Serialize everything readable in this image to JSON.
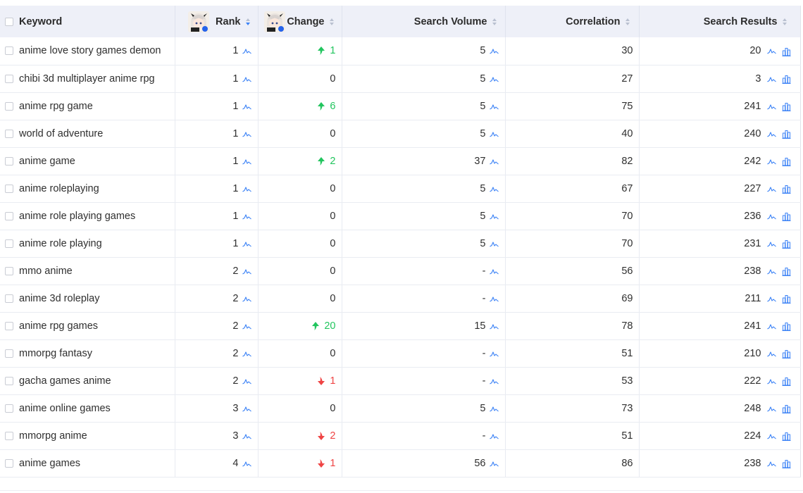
{
  "headers": {
    "keyword": "Keyword",
    "rank": "Rank",
    "change": "Change",
    "search_volume": "Search Volume",
    "correlation": "Correlation",
    "search_results": "Search Results"
  },
  "colors": {
    "up": "#22c55e",
    "down": "#ef4444",
    "icon": "#3b82f6",
    "header_bg": "#eef0f8"
  },
  "rows": [
    {
      "keyword": "anime love story games demon",
      "rank": "1",
      "change": "1",
      "dir": "up",
      "volume": "5",
      "correlation": "30",
      "results": "20"
    },
    {
      "keyword": "chibi 3d multiplayer anime rpg",
      "rank": "1",
      "change": "0",
      "dir": "none",
      "volume": "5",
      "correlation": "27",
      "results": "3"
    },
    {
      "keyword": "anime rpg game",
      "rank": "1",
      "change": "6",
      "dir": "up",
      "volume": "5",
      "correlation": "75",
      "results": "241"
    },
    {
      "keyword": "world of adventure",
      "rank": "1",
      "change": "0",
      "dir": "none",
      "volume": "5",
      "correlation": "40",
      "results": "240"
    },
    {
      "keyword": "anime game",
      "rank": "1",
      "change": "2",
      "dir": "up",
      "volume": "37",
      "correlation": "82",
      "results": "242"
    },
    {
      "keyword": "anime roleplaying",
      "rank": "1",
      "change": "0",
      "dir": "none",
      "volume": "5",
      "correlation": "67",
      "results": "227"
    },
    {
      "keyword": "anime role playing games",
      "rank": "1",
      "change": "0",
      "dir": "none",
      "volume": "5",
      "correlation": "70",
      "results": "236"
    },
    {
      "keyword": "anime role playing",
      "rank": "1",
      "change": "0",
      "dir": "none",
      "volume": "5",
      "correlation": "70",
      "results": "231"
    },
    {
      "keyword": "mmo anime",
      "rank": "2",
      "change": "0",
      "dir": "none",
      "volume": "-",
      "correlation": "56",
      "results": "238"
    },
    {
      "keyword": "anime 3d roleplay",
      "rank": "2",
      "change": "0",
      "dir": "none",
      "volume": "-",
      "correlation": "69",
      "results": "211"
    },
    {
      "keyword": "anime rpg games",
      "rank": "2",
      "change": "20",
      "dir": "up",
      "volume": "15",
      "correlation": "78",
      "results": "241"
    },
    {
      "keyword": "mmorpg fantasy",
      "rank": "2",
      "change": "0",
      "dir": "none",
      "volume": "-",
      "correlation": "51",
      "results": "210"
    },
    {
      "keyword": "gacha games anime",
      "rank": "2",
      "change": "1",
      "dir": "down",
      "volume": "-",
      "correlation": "53",
      "results": "222"
    },
    {
      "keyword": "anime online games",
      "rank": "3",
      "change": "0",
      "dir": "none",
      "volume": "5",
      "correlation": "73",
      "results": "248"
    },
    {
      "keyword": "mmorpg anime",
      "rank": "3",
      "change": "2",
      "dir": "down",
      "volume": "-",
      "correlation": "51",
      "results": "224"
    },
    {
      "keyword": "anime games",
      "rank": "4",
      "change": "1",
      "dir": "down",
      "volume": "56",
      "correlation": "86",
      "results": "238"
    }
  ]
}
